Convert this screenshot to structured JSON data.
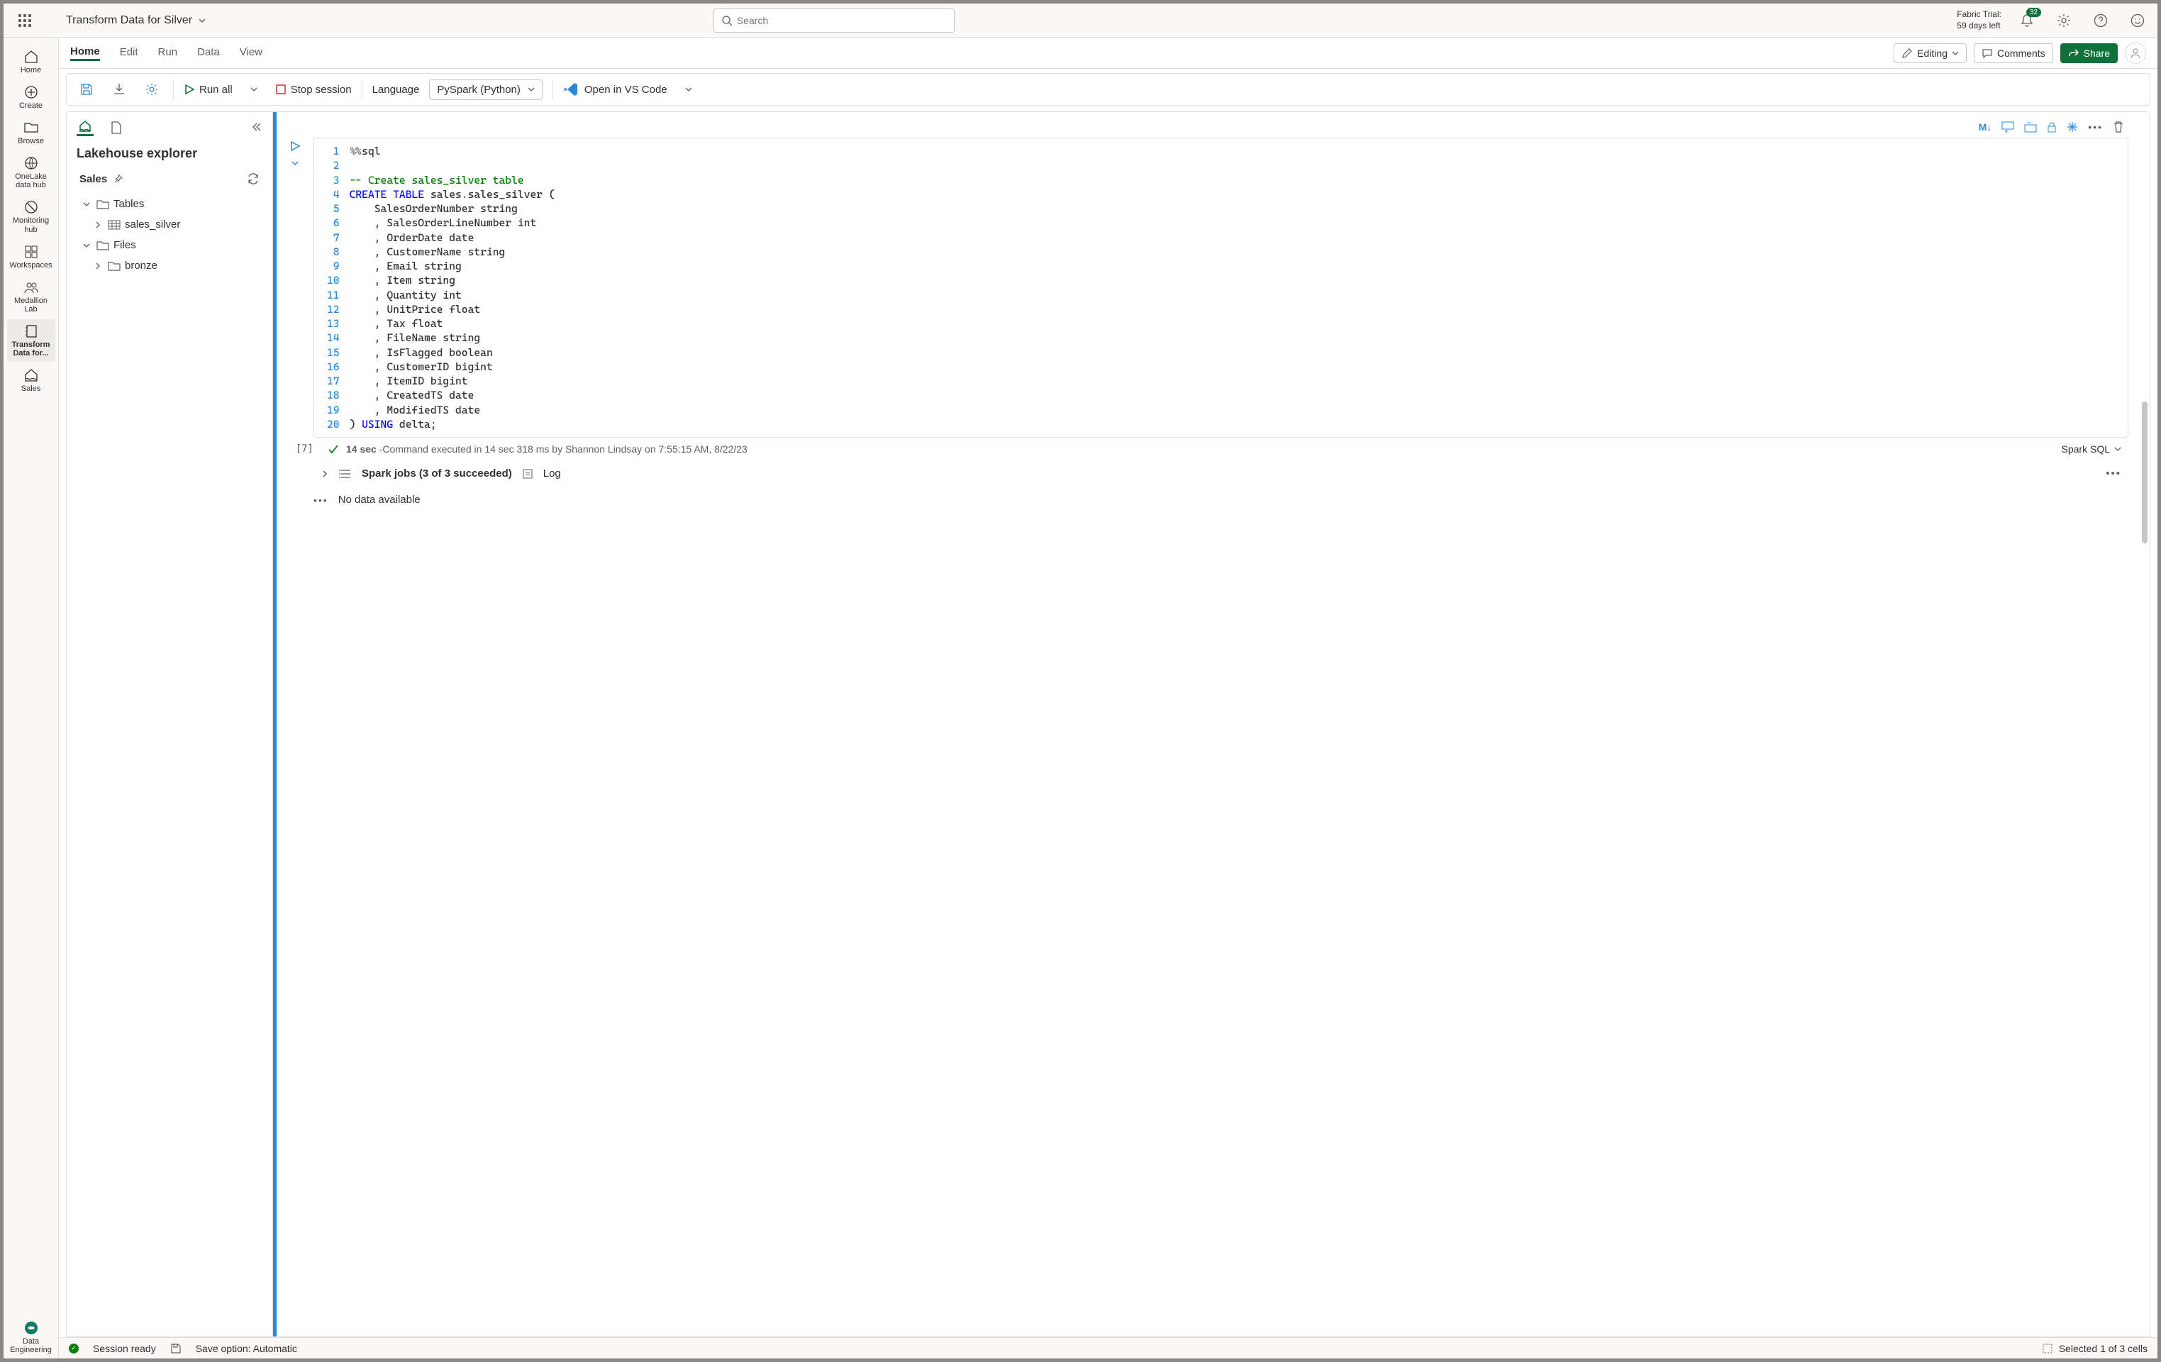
{
  "topbar": {
    "title": "Transform Data for Silver",
    "search_placeholder": "Search",
    "trial_line1": "Fabric Trial:",
    "trial_line2": "59 days left",
    "notification_count": "32"
  },
  "ribbon": {
    "tabs": [
      "Home",
      "Edit",
      "Run",
      "Data",
      "View"
    ],
    "editing": "Editing",
    "comments": "Comments",
    "share": "Share"
  },
  "toolbar": {
    "run_all": "Run all",
    "stop_session": "Stop session",
    "language_label": "Language",
    "language_value": "PySpark (Python)",
    "open_vscode": "Open in VS Code"
  },
  "leftnav": {
    "items": [
      {
        "label": "Home",
        "icon": "home"
      },
      {
        "label": "Create",
        "icon": "plus-circle"
      },
      {
        "label": "Browse",
        "icon": "folder"
      },
      {
        "label": "OneLake data hub",
        "icon": "onelake"
      },
      {
        "label": "Monitoring hub",
        "icon": "monitor"
      },
      {
        "label": "Workspaces",
        "icon": "workspaces"
      },
      {
        "label": "Medallion Lab",
        "icon": "people"
      },
      {
        "label": "Transform Data for...",
        "icon": "notebook",
        "active": true
      },
      {
        "label": "Sales",
        "icon": "lakehouse"
      }
    ],
    "footer": {
      "label": "Data Engineering",
      "icon": "data-eng"
    }
  },
  "sidebar": {
    "title": "Lakehouse explorer",
    "db_name": "Sales",
    "tree": {
      "tables_label": "Tables",
      "table1": "sales_silver",
      "files_label": "Files",
      "folder1": "bronze"
    }
  },
  "cell": {
    "toolbar_md": "M↓",
    "exec_count": "[7]",
    "code_lines": [
      {
        "n": 1,
        "tokens": [
          {
            "t": "magic",
            "v": "%%"
          },
          {
            "t": "plain",
            "v": "sql"
          }
        ]
      },
      {
        "n": 2,
        "tokens": []
      },
      {
        "n": 3,
        "tokens": [
          {
            "t": "comment",
            "v": "-- Create sales_silver table"
          }
        ]
      },
      {
        "n": 4,
        "tokens": [
          {
            "t": "keyword",
            "v": "CREATE"
          },
          {
            "t": "plain",
            "v": " "
          },
          {
            "t": "keyword",
            "v": "TABLE"
          },
          {
            "t": "plain",
            "v": " sales.sales_silver ("
          }
        ]
      },
      {
        "n": 5,
        "tokens": [
          {
            "t": "plain",
            "v": "    SalesOrderNumber string"
          }
        ]
      },
      {
        "n": 6,
        "tokens": [
          {
            "t": "plain",
            "v": "    , SalesOrderLineNumber int"
          }
        ]
      },
      {
        "n": 7,
        "tokens": [
          {
            "t": "plain",
            "v": "    , OrderDate date"
          }
        ]
      },
      {
        "n": 8,
        "tokens": [
          {
            "t": "plain",
            "v": "    , CustomerName string"
          }
        ]
      },
      {
        "n": 9,
        "tokens": [
          {
            "t": "plain",
            "v": "    , Email string"
          }
        ]
      },
      {
        "n": 10,
        "tokens": [
          {
            "t": "plain",
            "v": "    , Item string"
          }
        ]
      },
      {
        "n": 11,
        "tokens": [
          {
            "t": "plain",
            "v": "    , Quantity int"
          }
        ]
      },
      {
        "n": 12,
        "tokens": [
          {
            "t": "plain",
            "v": "    , UnitPrice float"
          }
        ]
      },
      {
        "n": 13,
        "tokens": [
          {
            "t": "plain",
            "v": "    , Tax float"
          }
        ]
      },
      {
        "n": 14,
        "tokens": [
          {
            "t": "plain",
            "v": "    , FileName string"
          }
        ]
      },
      {
        "n": 15,
        "tokens": [
          {
            "t": "plain",
            "v": "    , IsFlagged boolean"
          }
        ]
      },
      {
        "n": 16,
        "tokens": [
          {
            "t": "plain",
            "v": "    , CustomerID bigint"
          }
        ]
      },
      {
        "n": 17,
        "tokens": [
          {
            "t": "plain",
            "v": "    , ItemID bigint"
          }
        ]
      },
      {
        "n": 18,
        "tokens": [
          {
            "t": "plain",
            "v": "    , CreatedTS date"
          }
        ]
      },
      {
        "n": 19,
        "tokens": [
          {
            "t": "plain",
            "v": "    , ModifiedTS date"
          }
        ]
      },
      {
        "n": 20,
        "tokens": [
          {
            "t": "plain",
            "v": ") "
          },
          {
            "t": "keyword",
            "v": "USING"
          },
          {
            "t": "plain",
            "v": " delta;"
          }
        ]
      }
    ],
    "status_time": "14 sec",
    "status_text": " -Command executed in 14 sec 318 ms by Shannon Lindsay on 7:55:15 AM, 8/22/23",
    "lang_tag": "Spark SQL",
    "spark_jobs": "Spark jobs (3 of 3 succeeded)",
    "log_label": "Log",
    "no_data": "No data available"
  },
  "statusbar": {
    "session": "Session ready",
    "save": "Save option: Automatic",
    "selection": "Selected 1 of 3 cells"
  }
}
